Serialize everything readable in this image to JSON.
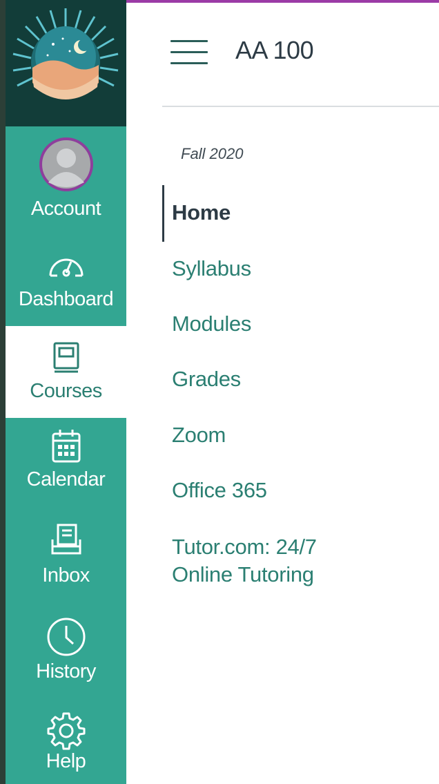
{
  "course": {
    "title": "AA 100",
    "term": "Fall 2020"
  },
  "global_nav": [
    {
      "label": "Account",
      "icon": "account-avatar"
    },
    {
      "label": "Dashboard",
      "icon": "dashboard-gauge-icon"
    },
    {
      "label": "Courses",
      "icon": "courses-book-icon",
      "active": true
    },
    {
      "label": "Calendar",
      "icon": "calendar-icon"
    },
    {
      "label": "Inbox",
      "icon": "inbox-icon"
    },
    {
      "label": "History",
      "icon": "history-clock-icon"
    },
    {
      "label": "Help",
      "icon": "help-gear-icon"
    }
  ],
  "course_nav": [
    {
      "label": "Home",
      "current": true
    },
    {
      "label": "Syllabus"
    },
    {
      "label": "Modules"
    },
    {
      "label": "Grades"
    },
    {
      "label": "Zoom"
    },
    {
      "label": "Office 365"
    },
    {
      "label": "Tutor.com: 24/7 Online Tutoring"
    }
  ],
  "colors": {
    "nav_background": "#33a692",
    "active_nav_text": "#2b7f72",
    "link_text": "#2b7f72",
    "top_accent": "#9b3ba6"
  }
}
